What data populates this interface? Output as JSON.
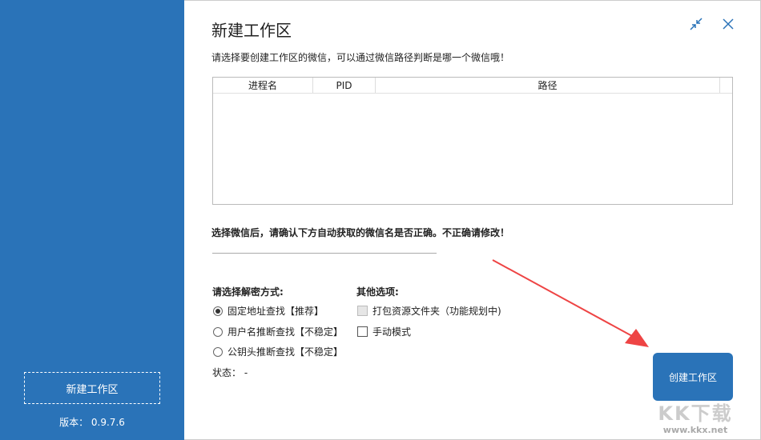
{
  "sidebar": {
    "new_workspace": "新建工作区",
    "version": "版本： 0.9.7.6"
  },
  "header": {
    "title": "新建工作区"
  },
  "hint": "请选择要创建工作区的微信，可以通过微信路径判断是哪一个微信哦！",
  "table": {
    "columns": [
      "进程名",
      "PID",
      "路径"
    ]
  },
  "confirm_hint": "选择微信后，请确认下方自动获取的微信名是否正确。不正确请修改！",
  "wechat_name": "",
  "decrypt": {
    "title": "请选择解密方式:",
    "options": [
      "固定地址查找【推荐】",
      "用户名推断查找【不稳定】",
      "公钥头推断查找【不稳定】"
    ],
    "selected": 0
  },
  "other": {
    "title": "其他选项:",
    "options": [
      "打包资源文件夹（功能规划中)",
      "手动模式"
    ]
  },
  "status": "状态： -",
  "create_button": "创建工作区",
  "watermark": {
    "logo": "KK下载",
    "url": "www.kkx.net"
  }
}
